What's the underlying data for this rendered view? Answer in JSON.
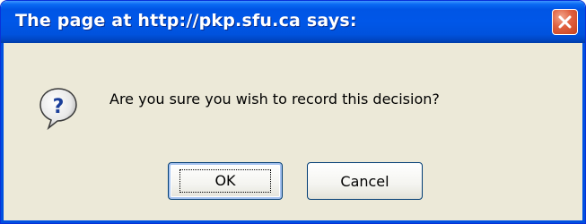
{
  "dialog": {
    "title": "The page at http://pkp.sfu.ca says:",
    "message": "Are you sure you wish to record this decision?",
    "icon": "question-icon",
    "close_icon": "close-icon",
    "ok_label": "OK",
    "cancel_label": "Cancel"
  },
  "colors": {
    "titlebar": "#0055e5",
    "body": "#ece9d8",
    "close_button": "#e0603f",
    "button_border": "#003c74"
  }
}
